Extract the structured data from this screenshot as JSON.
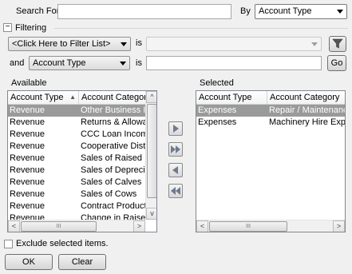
{
  "search": {
    "label": "Search For",
    "value": "",
    "by_label": "By",
    "by_value": "Account Type"
  },
  "filtering": {
    "toggle_symbol": "−",
    "label": "Filtering",
    "filter_list_value": "<Click Here to Filter List>",
    "is_label_1": "is",
    "is_value_1": "",
    "and_label": "and",
    "and_field_value": "Account Type",
    "is_label_2": "is",
    "is_value_2": "",
    "go_label": "Go"
  },
  "available": {
    "title": "Available",
    "columns": [
      "Account Type",
      "Account Category"
    ],
    "rows": [
      [
        "Revenue",
        "Other Business Inco"
      ],
      [
        "Revenue",
        "Returns & Allowance"
      ],
      [
        "Revenue",
        "CCC Loan Income"
      ],
      [
        "Revenue",
        "Cooperative Distribu"
      ],
      [
        "Revenue",
        "Sales of Raised Bree"
      ],
      [
        "Revenue",
        "Sales of Depreciable"
      ],
      [
        "Revenue",
        "Sales of Calves"
      ],
      [
        "Revenue",
        "Sales of Cows"
      ],
      [
        "Revenue",
        "Contract Production"
      ],
      [
        "Revenue",
        "Change in Raised Co"
      ]
    ],
    "selected_row": 0
  },
  "selected": {
    "title": "Selected",
    "columns": [
      "Account Type",
      "Account Category"
    ],
    "rows": [
      [
        "Expenses",
        "Repair / Maintenance Ex"
      ],
      [
        "Expenses",
        "Machinery Hire Expense"
      ]
    ],
    "selected_row": 0
  },
  "scroll": {
    "hthumb": "III"
  },
  "exclude_label": "Exclude selected items.",
  "buttons": {
    "ok": "OK",
    "clear": "Clear"
  },
  "colors": {
    "selection": "#9a9a9a",
    "move_arrow": "#6e7b8f"
  }
}
